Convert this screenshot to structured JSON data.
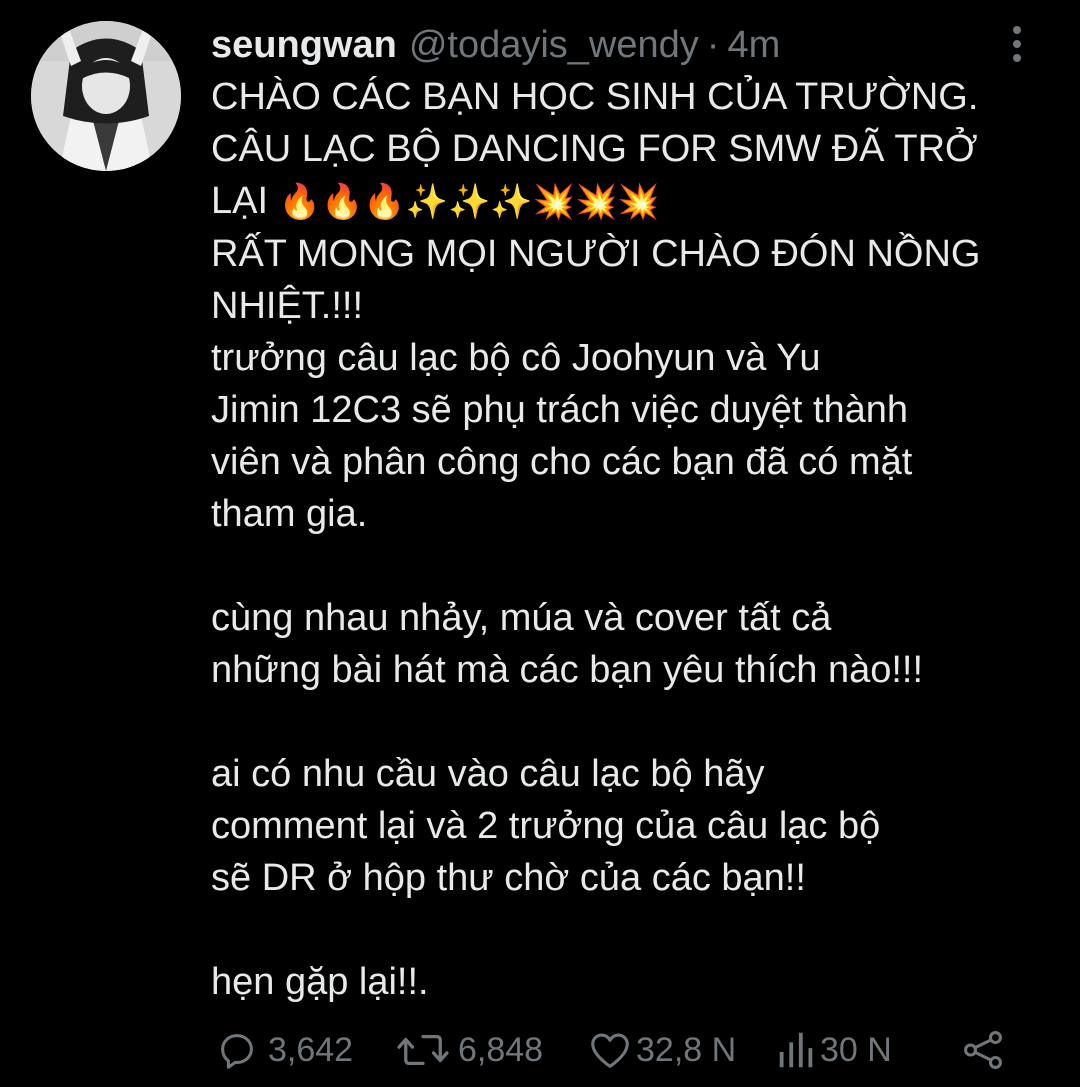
{
  "tweet": {
    "display_name": "seungwan",
    "handle": "@todayis_wendy",
    "separator": "·",
    "time": "4m",
    "lines": [
      "CHÀO CÁC BẠN HỌC SINH CỦA TRƯỜNG.",
      "CÂU LẠC BỘ DANCING FOR SMW ĐÃ TRỞ",
      "LẠI",
      "RẤT MONG MỌI NGƯỜI CHÀO ĐÓN NỒNG",
      "NHIỆT.!!!",
      "trưởng câu lạc bộ cô Joohyun và  Yu",
      "Jimin 12C3 sẽ phụ trách việc duyệt thành",
      "viên và phân công cho các bạn đã có mặt",
      "tham gia.",
      "cùng nhau nhảy, múa và cover tất cả",
      "những bài hát mà các bạn yêu thích nào!!!",
      "ai có nhu cầu vào câu lạc bộ hãy",
      "comment lại và 2 trưởng của câu lạc bộ",
      "sẽ DR ở hộp thư chờ của các bạn!!",
      "hẹn gặp lại!!."
    ],
    "emoji_row": "🔥🔥🔥✨✨✨💥💥💥"
  },
  "icons": {
    "more": "more-vertical-icon",
    "reply": "reply-icon",
    "retweet": "retweet-icon",
    "like": "heart-icon",
    "views": "views-icon",
    "share": "share-icon"
  },
  "actions": {
    "reply_count": "3,642",
    "retweet_count": "6,848",
    "like_count": "32,8 N",
    "view_count": "30 N"
  },
  "colors": {
    "background": "#000000",
    "text": "#e7e9ea",
    "secondary": "#71767b"
  }
}
